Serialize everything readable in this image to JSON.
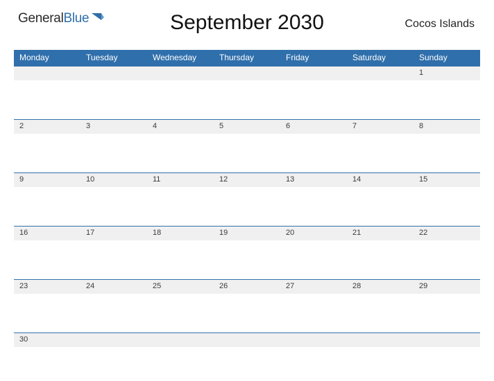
{
  "logo": {
    "prefix": "General",
    "suffix": "Blue"
  },
  "title": "September 2030",
  "region": "Cocos Islands",
  "day_names": [
    "Monday",
    "Tuesday",
    "Wednesday",
    "Thursday",
    "Friday",
    "Saturday",
    "Sunday"
  ],
  "weeks": [
    [
      "",
      "",
      "",
      "",
      "",
      "",
      "1"
    ],
    [
      "2",
      "3",
      "4",
      "5",
      "6",
      "7",
      "8"
    ],
    [
      "9",
      "10",
      "11",
      "12",
      "13",
      "14",
      "15"
    ],
    [
      "16",
      "17",
      "18",
      "19",
      "20",
      "21",
      "22"
    ],
    [
      "23",
      "24",
      "25",
      "26",
      "27",
      "28",
      "29"
    ],
    [
      "30",
      "",
      "",
      "",
      "",
      "",
      ""
    ]
  ]
}
